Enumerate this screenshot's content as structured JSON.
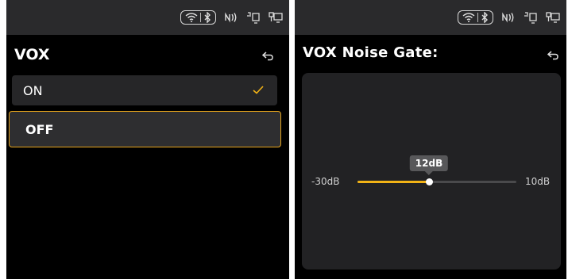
{
  "left_screen": {
    "status_icons": [
      "wifi-icon",
      "bluetooth-icon",
      "nfc-icon",
      "phone-link-icon",
      "computer-link-icon"
    ],
    "title": "VOX",
    "back_icon": "back-arrow-icon",
    "options": [
      {
        "label": "ON",
        "checked": true
      },
      {
        "label": "OFF",
        "focused": true
      }
    ]
  },
  "right_screen": {
    "status_icons": [
      "wifi-icon",
      "bluetooth-icon",
      "nfc-icon",
      "phone-link-icon",
      "computer-link-icon"
    ],
    "title": "VOX Noise Gate:",
    "back_icon": "back-arrow-icon",
    "slider": {
      "min_label": "-30dB",
      "max_label": "10dB",
      "value_label": "12dB",
      "fill_fraction": 0.45
    }
  },
  "colors": {
    "accent": "#f2b316",
    "focus_border": "#e6a51c",
    "statusbar": "#2a2a2c",
    "background": "#000000"
  }
}
